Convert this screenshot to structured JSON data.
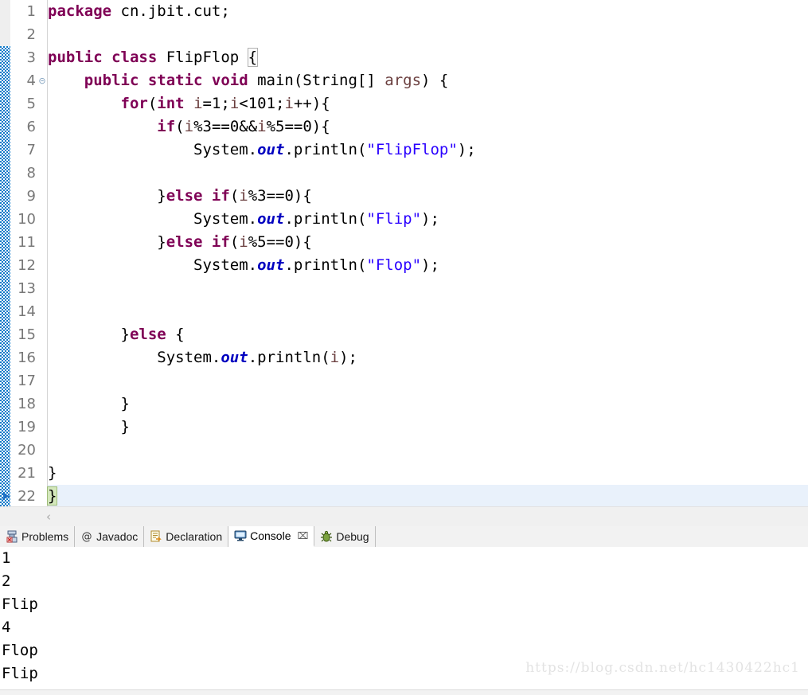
{
  "editor": {
    "first_line": 1,
    "last_line": 22,
    "current_line": 22,
    "change_bar_from_line": 3,
    "change_bar_to_line": 22,
    "fold_marker_line": 4,
    "lines": [
      {
        "n": 1,
        "indent": 0,
        "tokens": [
          {
            "t": "package ",
            "c": "kw"
          },
          {
            "t": "cn.jbit.cut;",
            "c": "plain"
          }
        ]
      },
      {
        "n": 2,
        "indent": 0,
        "tokens": []
      },
      {
        "n": 3,
        "indent": 0,
        "tokens": [
          {
            "t": "public class ",
            "c": "kw"
          },
          {
            "t": "FlipFlop ",
            "c": "plain"
          },
          {
            "t": "{",
            "c": "brk-grey"
          }
        ]
      },
      {
        "n": 4,
        "indent": 1,
        "tokens": [
          {
            "t": "public static void ",
            "c": "kw"
          },
          {
            "t": "main(String[] ",
            "c": "plain"
          },
          {
            "t": "args",
            "c": "var"
          },
          {
            "t": ") {",
            "c": "plain"
          }
        ]
      },
      {
        "n": 5,
        "indent": 2,
        "tokens": [
          {
            "t": "for",
            "c": "kw"
          },
          {
            "t": "(",
            "c": "plain"
          },
          {
            "t": "int ",
            "c": "kw"
          },
          {
            "t": "i",
            "c": "var"
          },
          {
            "t": "=1;",
            "c": "plain"
          },
          {
            "t": "i",
            "c": "var"
          },
          {
            "t": "<101;",
            "c": "plain"
          },
          {
            "t": "i",
            "c": "var"
          },
          {
            "t": "++){",
            "c": "plain"
          }
        ]
      },
      {
        "n": 6,
        "indent": 3,
        "tokens": [
          {
            "t": "if",
            "c": "kw"
          },
          {
            "t": "(",
            "c": "plain"
          },
          {
            "t": "i",
            "c": "var"
          },
          {
            "t": "%3==0&&",
            "c": "plain"
          },
          {
            "t": "i",
            "c": "var"
          },
          {
            "t": "%5==0){",
            "c": "plain"
          }
        ]
      },
      {
        "n": 7,
        "indent": 4,
        "tokens": [
          {
            "t": "System.",
            "c": "plain"
          },
          {
            "t": "out",
            "c": "fld"
          },
          {
            "t": ".println(",
            "c": "plain"
          },
          {
            "t": "\"FlipFlop\"",
            "c": "str"
          },
          {
            "t": ");",
            "c": "plain"
          }
        ]
      },
      {
        "n": 8,
        "indent": 0,
        "tokens": []
      },
      {
        "n": 9,
        "indent": 3,
        "tokens": [
          {
            "t": "}",
            "c": "plain"
          },
          {
            "t": "else if",
            "c": "kw"
          },
          {
            "t": "(",
            "c": "plain"
          },
          {
            "t": "i",
            "c": "var"
          },
          {
            "t": "%3==0){",
            "c": "plain"
          }
        ]
      },
      {
        "n": 10,
        "indent": 4,
        "tokens": [
          {
            "t": "System.",
            "c": "plain"
          },
          {
            "t": "out",
            "c": "fld"
          },
          {
            "t": ".println(",
            "c": "plain"
          },
          {
            "t": "\"Flip\"",
            "c": "str"
          },
          {
            "t": ");",
            "c": "plain"
          }
        ]
      },
      {
        "n": 11,
        "indent": 3,
        "tokens": [
          {
            "t": "}",
            "c": "plain"
          },
          {
            "t": "else if",
            "c": "kw"
          },
          {
            "t": "(",
            "c": "plain"
          },
          {
            "t": "i",
            "c": "var"
          },
          {
            "t": "%5==0){",
            "c": "plain"
          }
        ]
      },
      {
        "n": 12,
        "indent": 4,
        "tokens": [
          {
            "t": "System.",
            "c": "plain"
          },
          {
            "t": "out",
            "c": "fld"
          },
          {
            "t": ".println(",
            "c": "plain"
          },
          {
            "t": "\"Flop\"",
            "c": "str"
          },
          {
            "t": ");",
            "c": "plain"
          }
        ]
      },
      {
        "n": 13,
        "indent": 0,
        "tokens": []
      },
      {
        "n": 14,
        "indent": 0,
        "tokens": []
      },
      {
        "n": 15,
        "indent": 2,
        "tokens": [
          {
            "t": "}",
            "c": "plain"
          },
          {
            "t": "else",
            "c": "kw"
          },
          {
            "t": " {",
            "c": "plain"
          }
        ]
      },
      {
        "n": 16,
        "indent": 3,
        "tokens": [
          {
            "t": "System.",
            "c": "plain"
          },
          {
            "t": "out",
            "c": "fld"
          },
          {
            "t": ".println(",
            "c": "plain"
          },
          {
            "t": "i",
            "c": "var"
          },
          {
            "t": ");",
            "c": "plain"
          }
        ]
      },
      {
        "n": 17,
        "indent": 0,
        "tokens": []
      },
      {
        "n": 18,
        "indent": 2,
        "tokens": [
          {
            "t": "}",
            "c": "plain"
          }
        ]
      },
      {
        "n": 19,
        "indent": 2,
        "tokens": [
          {
            "t": "}",
            "c": "plain"
          }
        ]
      },
      {
        "n": 20,
        "indent": 0,
        "tokens": []
      },
      {
        "n": 21,
        "indent": 0,
        "tokens": [
          {
            "t": "}",
            "c": "plain"
          }
        ]
      },
      {
        "n": 22,
        "indent": 0,
        "tokens": [
          {
            "t": "}",
            "c": "brk-green"
          }
        ]
      }
    ]
  },
  "scrollbar": {
    "left_arrow_glyph": "‹"
  },
  "bottom_panel": {
    "tabs": [
      {
        "label": "Problems",
        "icon": "problems-icon",
        "active": false,
        "closable": false
      },
      {
        "label": "Javadoc",
        "icon": "javadoc-icon",
        "active": false,
        "closable": false
      },
      {
        "label": "Declaration",
        "icon": "declaration-icon",
        "active": false,
        "closable": false
      },
      {
        "label": "Console",
        "icon": "console-icon",
        "active": true,
        "closable": true,
        "close_glyph": "⌧"
      },
      {
        "label": "Debug",
        "icon": "debug-icon",
        "active": false,
        "closable": false
      }
    ],
    "console_output": [
      "1",
      "2",
      "Flip",
      "4",
      "Flop",
      "Flip"
    ]
  },
  "watermark": {
    "text": "https://blog.csdn.net/hc1430422hc1"
  },
  "colors": {
    "keyword": "#7f0055",
    "string": "#2a00ff",
    "field": "#0000c0",
    "variable": "#6a3e3e",
    "line_number": "#787878",
    "current_line_bg": "#e9f1fb",
    "bracket_match_bg": "#d4e8bc",
    "change_bar": "#0a78c8",
    "watermark": "#e3e3e3"
  }
}
